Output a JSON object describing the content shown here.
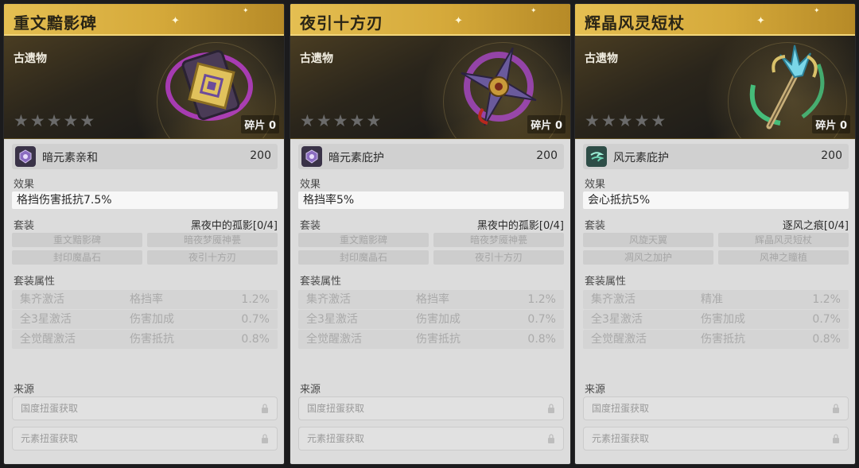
{
  "cards": [
    {
      "title": "重文黯影碑",
      "category": "古遗物",
      "fragment": "碎片 0",
      "affix": {
        "name": "暗元素亲和",
        "value": "200"
      },
      "effect_label": "效果",
      "effect": "格挡伤害抵抗7.5%",
      "set_label": "套装",
      "set_name": "黑夜中的孤影[0/4]",
      "set_pieces": [
        "重文黯影碑",
        "暗夜梦魇神甍",
        "封印魔晶石",
        "夜引十方刃"
      ],
      "attr_label": "套装属性",
      "attributes": [
        {
          "condition": "集齐激活",
          "stat": "格挡率",
          "value": "1.2%"
        },
        {
          "condition": "全3星激活",
          "stat": "伤害加成",
          "value": "0.7%"
        },
        {
          "condition": "全觉醒激活",
          "stat": "伤害抵抗",
          "value": "0.8%"
        }
      ],
      "source_label": "来源",
      "sources": [
        "国度扭蛋获取",
        "元素扭蛋获取"
      ]
    },
    {
      "title": "夜引十方刃",
      "category": "古遗物",
      "fragment": "碎片 0",
      "affix": {
        "name": "暗元素庇护",
        "value": "200"
      },
      "effect_label": "效果",
      "effect": "格挡率5%",
      "set_label": "套装",
      "set_name": "黑夜中的孤影[0/4]",
      "set_pieces": [
        "重文黯影碑",
        "暗夜梦魇神甍",
        "封印魔晶石",
        "夜引十方刃"
      ],
      "attr_label": "套装属性",
      "attributes": [
        {
          "condition": "集齐激活",
          "stat": "格挡率",
          "value": "1.2%"
        },
        {
          "condition": "全3星激活",
          "stat": "伤害加成",
          "value": "0.7%"
        },
        {
          "condition": "全觉醒激活",
          "stat": "伤害抵抗",
          "value": "0.8%"
        }
      ],
      "source_label": "来源",
      "sources": [
        "国度扭蛋获取",
        "元素扭蛋获取"
      ]
    },
    {
      "title": "辉晶风灵短杖",
      "category": "古遗物",
      "fragment": "碎片 0",
      "affix": {
        "name": "风元素庇护",
        "value": "200"
      },
      "effect_label": "效果",
      "effect": "会心抵抗5%",
      "set_label": "套装",
      "set_name": "逐风之痕[0/4]",
      "set_pieces": [
        "风旋天翼",
        "辉晶风灵短杖",
        "凋风之加护",
        "风神之瞳植"
      ],
      "attr_label": "套装属性",
      "attributes": [
        {
          "condition": "集齐激活",
          "stat": "精准",
          "value": "1.2%"
        },
        {
          "condition": "全3星激活",
          "stat": "伤害加成",
          "value": "0.7%"
        },
        {
          "condition": "全觉醒激活",
          "stat": "伤害抵抗",
          "value": "0.8%"
        }
      ],
      "source_label": "来源",
      "sources": [
        "国度扭蛋获取",
        "元素扭蛋获取"
      ]
    }
  ],
  "colors": {
    "title_gold": "#e5bf52",
    "dark_element": "#3a3348",
    "wind_element": "#2e4d47",
    "panel_bg": "#dcdcdc"
  },
  "icons": {
    "affix_dark": "dark-element-icon",
    "affix_wind": "wind-element-icon",
    "star": "star-icon",
    "lock": "lock-icon"
  }
}
